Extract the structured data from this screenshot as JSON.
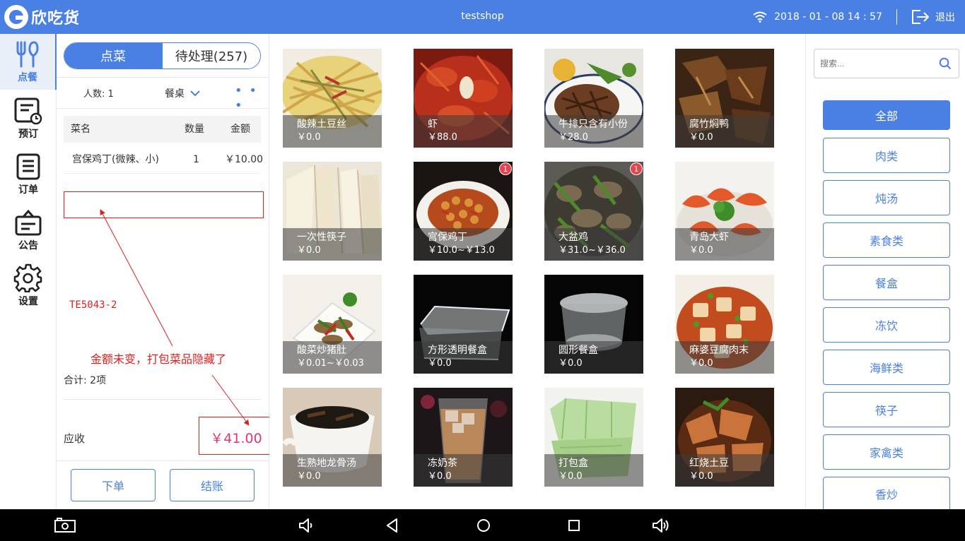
{
  "app": {
    "logo_text": "欣吃货",
    "shop_name": "testshop",
    "datetime": "2018 - 01 - 08  14 : 57",
    "logout_label": "退出"
  },
  "nav": [
    {
      "label": "点餐",
      "icon": "fork-knife-icon",
      "active": true
    },
    {
      "label": "预订",
      "icon": "reservation-icon",
      "active": false
    },
    {
      "label": "订单",
      "icon": "order-list-icon",
      "active": false
    },
    {
      "label": "公告",
      "icon": "announcement-icon",
      "active": false
    },
    {
      "label": "设置",
      "icon": "gear-icon",
      "active": false
    }
  ],
  "order": {
    "tabs": [
      {
        "label": "点菜",
        "active": true
      },
      {
        "label": "待处理(257)",
        "active": false
      }
    ],
    "people": "人数: 1",
    "table_label": "餐桌",
    "more": "• • •",
    "columns": [
      "菜名",
      "数量",
      "金额"
    ],
    "items": [
      {
        "name": "宫保鸡丁(微辣、小)",
        "qty": "1",
        "amount": "￥10.00"
      }
    ],
    "summary": "合计:  2项",
    "due_label": "应收",
    "due_amount": "￥41.00",
    "place_order_label": "下单",
    "checkout_label": "结账"
  },
  "annotations": {
    "code": "TE5043-2",
    "note": "金额未变，打包菜品隐藏了",
    "color": "#e01e1e"
  },
  "dishes": [
    {
      "name": "酸辣土豆丝",
      "price": "￥0.0"
    },
    {
      "name": "虾",
      "price": "￥88.0"
    },
    {
      "name": "牛排只含有小份",
      "price": "￥28.0"
    },
    {
      "name": "腐竹焖鸭",
      "price": "￥0.0"
    },
    {
      "name": "一次性筷子",
      "price": "￥0.0"
    },
    {
      "name": "宫保鸡丁",
      "price": "￥10.0~￥13.0",
      "badge": "1"
    },
    {
      "name": "大盆鸡",
      "price": "￥31.0~￥36.0",
      "badge": "1"
    },
    {
      "name": "青岛大虾",
      "price": "￥0.0"
    },
    {
      "name": "酸菜炒猪肚",
      "price": "￥0.01~￥0.03"
    },
    {
      "name": "方形透明餐盒",
      "price": "￥0.0"
    },
    {
      "name": "圆形餐盒",
      "price": "￥0.0"
    },
    {
      "name": "麻婆豆腐肉末",
      "price": "￥0.0"
    },
    {
      "name": "生熟地龙骨汤",
      "price": "￥0.0"
    },
    {
      "name": "冻奶茶",
      "price": "￥0.0"
    },
    {
      "name": "打包盒",
      "price": "￥0.0"
    },
    {
      "name": "红烧土豆",
      "price": "￥0.0"
    }
  ],
  "search": {
    "placeholder": "搜索..."
  },
  "categories": [
    {
      "label": "全部",
      "selected": true
    },
    {
      "label": "肉类"
    },
    {
      "label": "炖汤"
    },
    {
      "label": "素食类"
    },
    {
      "label": "餐盒"
    },
    {
      "label": "冻饮"
    },
    {
      "label": "海鲜类"
    },
    {
      "label": "筷子"
    },
    {
      "label": "家禽类"
    },
    {
      "label": "香炒"
    }
  ],
  "colors": {
    "primary": "#4a7fe4",
    "price_red": "#e8346c",
    "badge_red": "#e8424c"
  },
  "system_bar": [
    "screenshot-icon",
    "volume-down-icon",
    "back-icon",
    "home-icon",
    "recents-icon",
    "volume-up-icon"
  ]
}
